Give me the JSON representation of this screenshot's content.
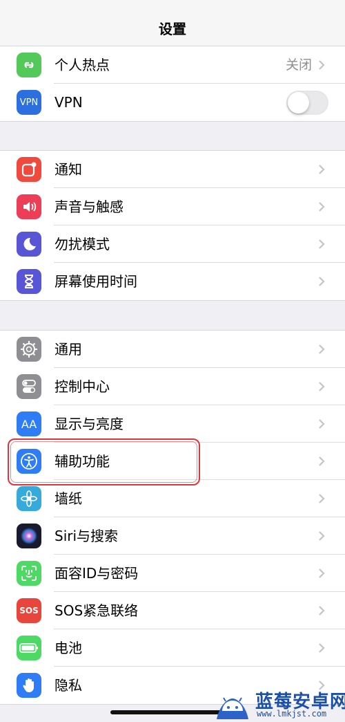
{
  "nav": {
    "title": "设置"
  },
  "group1": [
    {
      "label": "个人热点",
      "value": "关闭",
      "icon": "hotspot-icon",
      "color": "#53c95a"
    },
    {
      "label": "VPN",
      "icon": "vpn-icon",
      "icon_text": "VPN",
      "color": "#2e6fe0",
      "toggle": "off"
    }
  ],
  "group2": [
    {
      "label": "通知",
      "icon": "notifications-icon",
      "color": "#ef4a3d"
    },
    {
      "label": "声音与触感",
      "icon": "speaker-icon",
      "color": "#ec3e56"
    },
    {
      "label": "勿扰模式",
      "icon": "moon-icon",
      "color": "#5856d6"
    },
    {
      "label": "屏幕使用时间",
      "icon": "hourglass-icon",
      "color": "#5856d6"
    }
  ],
  "group3": [
    {
      "label": "通用",
      "icon": "gear-icon",
      "color": "#8e8e93"
    },
    {
      "label": "控制中心",
      "icon": "switches-icon",
      "color": "#8e8e93"
    },
    {
      "label": "显示与亮度",
      "icon": "display-aa-icon",
      "icon_text": "AA",
      "color": "#2e7cf6"
    },
    {
      "label": "辅助功能",
      "icon": "accessibility-icon",
      "color": "#2e7cf6"
    },
    {
      "label": "墙纸",
      "icon": "flower-icon",
      "color": "#37aadc"
    },
    {
      "label": "Siri与搜索",
      "icon": "siri-icon",
      "color": "#1a1a2e"
    },
    {
      "label": "面容ID与密码",
      "icon": "faceid-icon",
      "color": "#4cd964"
    },
    {
      "label": "SOS紧急联络",
      "icon": "sos-icon",
      "icon_text": "SOS",
      "color": "#e8453c"
    },
    {
      "label": "电池",
      "icon": "battery-icon",
      "color": "#4cd964"
    },
    {
      "label": "隐私",
      "icon": "hand-icon",
      "color": "#2e7cf6"
    }
  ],
  "watermark": {
    "brand": "蓝莓安卓网",
    "url": "www.lmkjst.com"
  }
}
